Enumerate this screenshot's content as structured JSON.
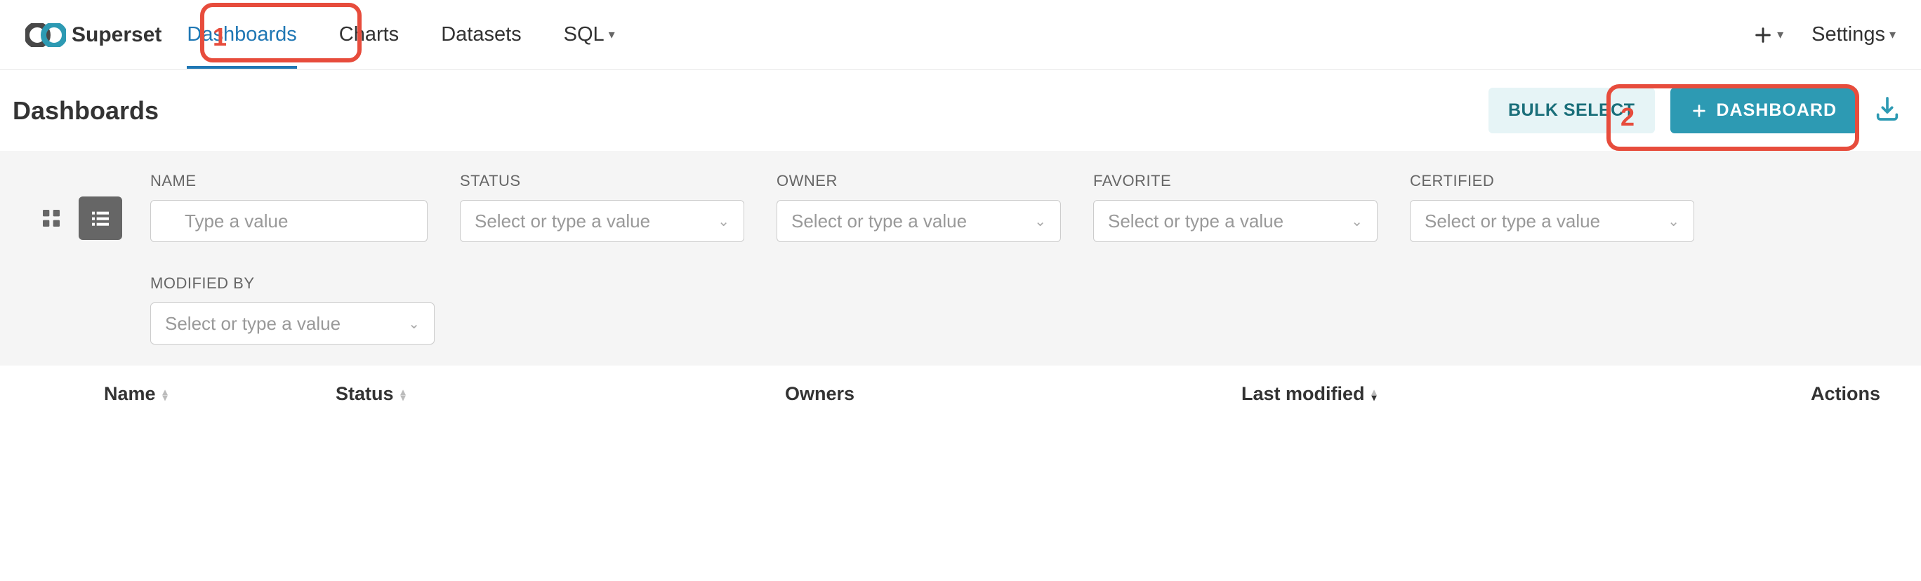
{
  "brand": "Superset",
  "nav": {
    "dashboards": "Dashboards",
    "charts": "Charts",
    "datasets": "Datasets",
    "sql": "SQL"
  },
  "settings_label": "Settings",
  "page_title": "Dashboards",
  "actions": {
    "bulk_select": "BULK SELECT",
    "new_dashboard": "DASHBOARD"
  },
  "filters": {
    "name": {
      "label": "NAME",
      "placeholder": "Type a value"
    },
    "status": {
      "label": "STATUS",
      "placeholder": "Select or type a value"
    },
    "owner": {
      "label": "OWNER",
      "placeholder": "Select or type a value"
    },
    "favorite": {
      "label": "FAVORITE",
      "placeholder": "Select or type a value"
    },
    "certified": {
      "label": "CERTIFIED",
      "placeholder": "Select or type a value"
    },
    "modified_by": {
      "label": "MODIFIED BY",
      "placeholder": "Select or type a value"
    }
  },
  "table_headers": {
    "name": "Name",
    "status": "Status",
    "owners": "Owners",
    "last_modified": "Last modified",
    "actions": "Actions"
  },
  "callouts": {
    "one": "1",
    "two": "2"
  }
}
